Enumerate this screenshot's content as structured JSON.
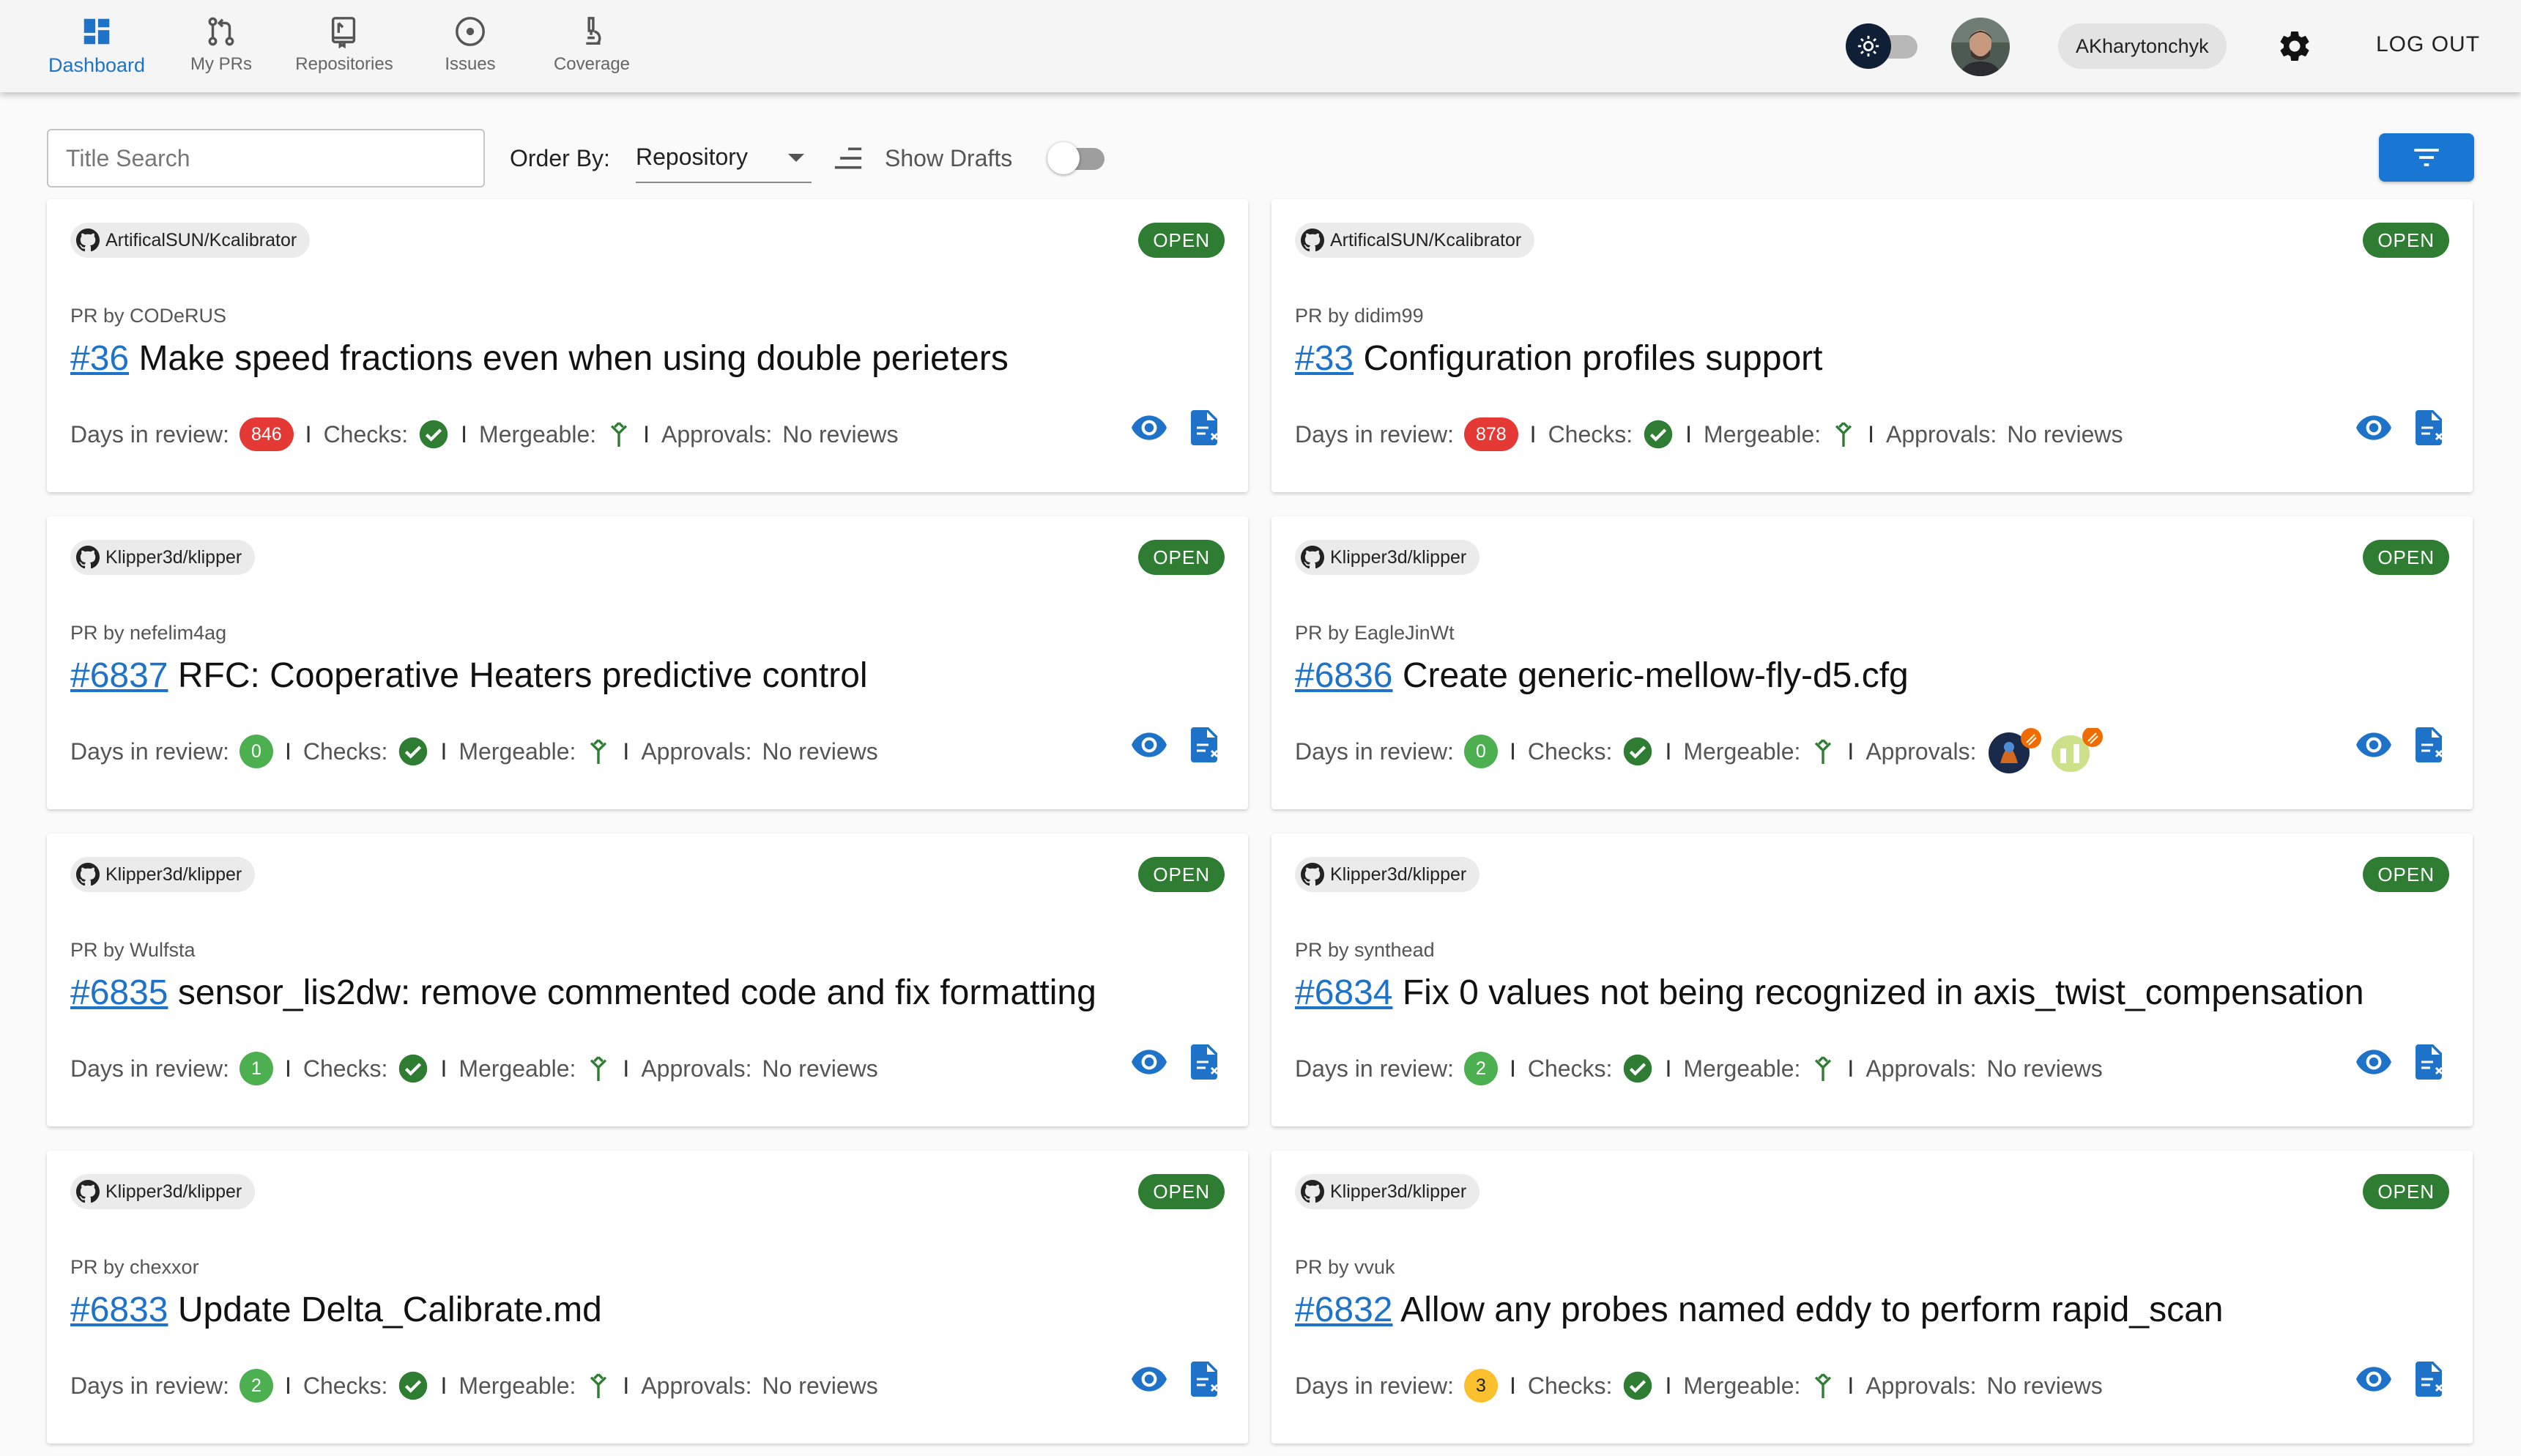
{
  "nav": {
    "items": [
      {
        "label": "Dashboard",
        "icon": "dashboard-icon",
        "active": true
      },
      {
        "label": "My PRs",
        "icon": "pull-request-icon",
        "active": false
      },
      {
        "label": "Repositories",
        "icon": "repository-icon",
        "active": false
      },
      {
        "label": "Issues",
        "icon": "issue-icon",
        "active": false
      },
      {
        "label": "Coverage",
        "icon": "microscope-icon",
        "active": false
      }
    ]
  },
  "header": {
    "username": "AKharytonchyk",
    "logout_label": "LOG OUT",
    "theme_icon": "sun-icon",
    "settings_icon": "gear-icon"
  },
  "toolbar": {
    "search_placeholder": "Title Search",
    "order_label": "Order By:",
    "order_value": "Repository",
    "drafts_label": "Show Drafts",
    "drafts_enabled": false
  },
  "labels": {
    "pr_by": "PR by",
    "days": "Days in review:",
    "checks": "Checks:",
    "mergeable": "Mergeable:",
    "approvals": "Approvals:",
    "sep": "I"
  },
  "colors": {
    "accent": "#1976d2",
    "open": "#2e7d32",
    "days_red": "#e53935",
    "days_green": "#4caf50",
    "days_yellow": "#fbc02d",
    "check": "#2e7d32"
  },
  "prs": [
    {
      "repo": "ArtificalSUN/Kcalibrator",
      "status": "OPEN",
      "author": "PR by CODeRUS",
      "number": "#36",
      "title": "Make speed fractions even when using double perieters",
      "days": "846",
      "days_color": "red",
      "checks": "passed",
      "mergeable": true,
      "approvals": "No reviews"
    },
    {
      "repo": "ArtificalSUN/Kcalibrator",
      "status": "OPEN",
      "author": "PR by didim99",
      "number": "#33",
      "title": "Configuration profiles support",
      "days": "878",
      "days_color": "red",
      "checks": "passed",
      "mergeable": true,
      "approvals": "No reviews"
    },
    {
      "repo": "Klipper3d/klipper",
      "status": "OPEN",
      "author": "PR by nefelim4ag",
      "number": "#6837",
      "title": "RFC: Cooperative Heaters predictive control",
      "days": "0",
      "days_color": "green",
      "checks": "passed",
      "mergeable": true,
      "approvals": "No reviews"
    },
    {
      "repo": "Klipper3d/klipper",
      "status": "OPEN",
      "author": "PR by EagleJinWt",
      "number": "#6836",
      "title": "Create generic-mellow-fly-d5.cfg",
      "days": "0",
      "days_color": "green",
      "checks": "passed",
      "mergeable": true,
      "approvals": "",
      "approval_avatars": true
    },
    {
      "repo": "Klipper3d/klipper",
      "status": "OPEN",
      "author": "PR by Wulfsta",
      "number": "#6835",
      "title": "sensor_lis2dw: remove commented code and fix formatting",
      "days": "1",
      "days_color": "green",
      "checks": "passed",
      "mergeable": true,
      "approvals": "No reviews"
    },
    {
      "repo": "Klipper3d/klipper",
      "status": "OPEN",
      "author": "PR by synthead",
      "number": "#6834",
      "title": "Fix 0 values not being recognized in axis_twist_compensation",
      "days": "2",
      "days_color": "green",
      "checks": "passed",
      "mergeable": true,
      "approvals": "No reviews"
    },
    {
      "repo": "Klipper3d/klipper",
      "status": "OPEN",
      "author": "PR by chexxor",
      "number": "#6833",
      "title": "Update Delta_Calibrate.md",
      "days": "2",
      "days_color": "green",
      "checks": "passed",
      "mergeable": true,
      "approvals": "No reviews"
    },
    {
      "repo": "Klipper3d/klipper",
      "status": "OPEN",
      "author": "PR by vvuk",
      "number": "#6832",
      "title": "Allow any probes named eddy to perform rapid_scan",
      "days": "3",
      "days_color": "yellow",
      "checks": "passed",
      "mergeable": true,
      "approvals": "No reviews"
    }
  ]
}
